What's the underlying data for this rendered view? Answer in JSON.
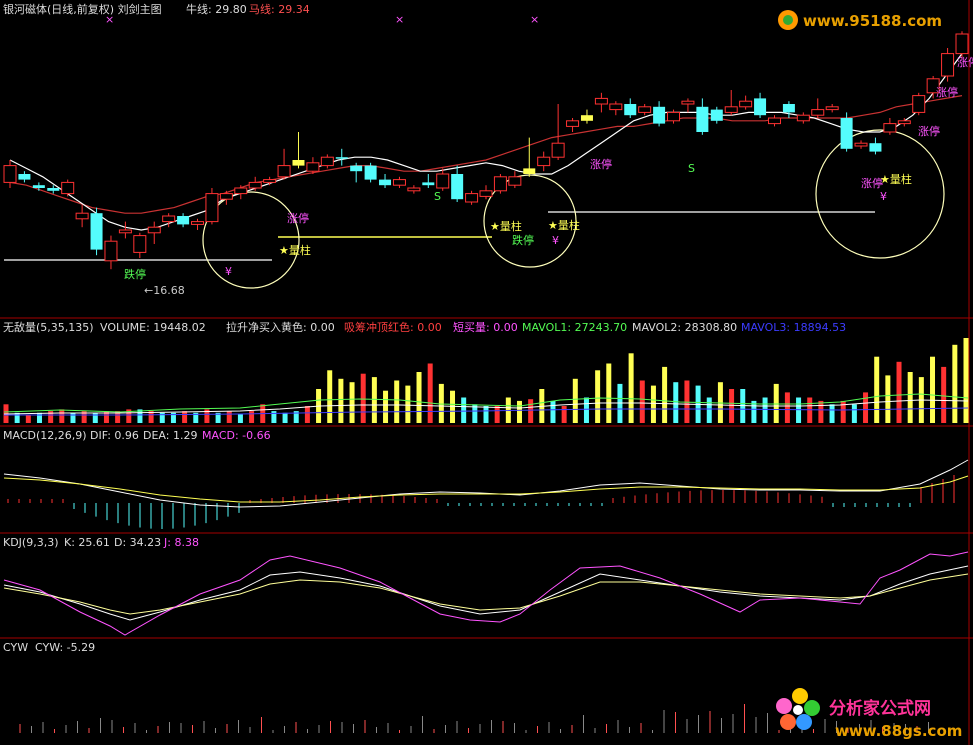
{
  "colors": {
    "background": "#000000",
    "up_candle": "#ff3232",
    "down_candle": "#54fcfc",
    "highlight_candle": "#ffff54",
    "panel_border": "#a40000",
    "ma_bull": "#ffffff",
    "ma_horse": "#c83232",
    "dif": "#ffffff",
    "dea": "#ffff54",
    "macd": "#ff54ff",
    "mavol2": "#ffffff",
    "mavol3": "#3c3cff"
  },
  "main_panel": {
    "title": "银河磁体(日线,前复权) 刘剑主图",
    "bull_label": "牛线: 29.80",
    "horse_label": "马线: 29.34",
    "low_marker": "←16.68",
    "annotations": {
      "zhangting": "涨停",
      "dieting": "跌停",
      "liangzhu": "★量柱",
      "yuan": "¥",
      "s": "S"
    }
  },
  "volume_panel": {
    "title": "无敌量(5,35,135)",
    "volume": "VOLUME: 19448.02",
    "buy": "拉升净买入黄色: 0.00",
    "sell": "吸筹冲顶红色: 0.00",
    "short": "短买量: 0.00",
    "mavol1": "MAVOL1: 27243.70",
    "mavol2": "MAVOL2: 28308.80",
    "mavol3": "MAVOL3: 18894.53"
  },
  "macd_panel": {
    "title": "MACD(12,26,9)",
    "dif": "DIF: 0.96",
    "dea": "DEA: 1.29",
    "macd": "MACD: -0.66"
  },
  "kdj_panel": {
    "title": "KDJ(9,3,3)",
    "k": "K: 25.61",
    "d": "D: 34.23",
    "j": "J: 8.38"
  },
  "cyw_panel": {
    "title": "CYW",
    "cyw": "CYW: -5.29"
  },
  "watermarks": {
    "top": "www.95188.com",
    "bottom_brand": "分析家公式网",
    "bottom_url": "www.88gs.com"
  },
  "chart_data": [
    {
      "type": "candlestick",
      "panel": "main",
      "series_labels": [
        "牛线: 29.80",
        "马线: 29.34"
      ],
      "last": {
        "bull_line": 29.8,
        "horse_line": 29.34
      },
      "annotated_low": 16.68,
      "candles": [
        {
          "o": 0.58,
          "c": 0.52,
          "h": 0.5,
          "l": 0.6
        },
        {
          "o": 0.55,
          "c": 0.57,
          "h": 0.54,
          "l": 0.58
        },
        {
          "o": 0.59,
          "c": 0.6,
          "h": 0.58,
          "l": 0.61
        },
        {
          "o": 0.6,
          "c": 0.61,
          "h": 0.59,
          "l": 0.62
        },
        {
          "o": 0.62,
          "c": 0.58,
          "h": 0.57,
          "l": 0.63
        },
        {
          "o": 0.71,
          "c": 0.69,
          "h": 0.66,
          "l": 0.74
        },
        {
          "o": 0.69,
          "c": 0.82,
          "h": 0.67,
          "l": 0.84
        },
        {
          "o": 0.86,
          "c": 0.79,
          "h": 0.77,
          "l": 0.89
        },
        {
          "o": 0.76,
          "c": 0.75,
          "h": 0.72,
          "l": 0.78
        },
        {
          "o": 0.83,
          "c": 0.77,
          "h": 0.76,
          "l": 0.85
        },
        {
          "o": 0.76,
          "c": 0.74,
          "h": 0.72,
          "l": 0.8
        },
        {
          "o": 0.72,
          "c": 0.7,
          "h": 0.69,
          "l": 0.74
        },
        {
          "o": 0.7,
          "c": 0.73,
          "h": 0.69,
          "l": 0.74
        },
        {
          "o": 0.73,
          "c": 0.72,
          "h": 0.71,
          "l": 0.75
        },
        {
          "o": 0.72,
          "c": 0.62,
          "h": 0.6,
          "l": 0.73
        },
        {
          "o": 0.64,
          "c": 0.62,
          "h": 0.61,
          "l": 0.66
        },
        {
          "o": 0.62,
          "c": 0.6,
          "h": 0.59,
          "l": 0.64
        },
        {
          "o": 0.6,
          "c": 0.58,
          "h": 0.56,
          "l": 0.61
        },
        {
          "o": 0.58,
          "c": 0.57,
          "h": 0.56,
          "l": 0.59
        },
        {
          "o": 0.56,
          "c": 0.52,
          "h": 0.46,
          "l": 0.57
        },
        {
          "o": 0.52,
          "c": 0.5,
          "h": 0.4,
          "l": 0.53
        },
        {
          "o": 0.54,
          "c": 0.51,
          "h": 0.49,
          "l": 0.55
        },
        {
          "o": 0.52,
          "c": 0.49,
          "h": 0.48,
          "l": 0.53
        },
        {
          "o": 0.49,
          "c": 0.49,
          "h": 0.46,
          "l": 0.52
        },
        {
          "o": 0.52,
          "c": 0.54,
          "h": 0.51,
          "l": 0.58
        },
        {
          "o": 0.52,
          "c": 0.57,
          "h": 0.51,
          "l": 0.58
        },
        {
          "o": 0.57,
          "c": 0.59,
          "h": 0.55,
          "l": 0.6
        },
        {
          "o": 0.59,
          "c": 0.57,
          "h": 0.56,
          "l": 0.6
        },
        {
          "o": 0.61,
          "c": 0.6,
          "h": 0.59,
          "l": 0.62
        },
        {
          "o": 0.58,
          "c": 0.59,
          "h": 0.55,
          "l": 0.6
        },
        {
          "o": 0.6,
          "c": 0.55,
          "h": 0.53,
          "l": 0.61
        },
        {
          "o": 0.55,
          "c": 0.64,
          "h": 0.52,
          "l": 0.65
        },
        {
          "o": 0.65,
          "c": 0.62,
          "h": 0.61,
          "l": 0.66
        },
        {
          "o": 0.63,
          "c": 0.61,
          "h": 0.59,
          "l": 0.64
        },
        {
          "o": 0.61,
          "c": 0.56,
          "h": 0.55,
          "l": 0.62
        },
        {
          "o": 0.59,
          "c": 0.56,
          "h": 0.54,
          "l": 0.6
        },
        {
          "o": 0.55,
          "c": 0.53,
          "h": 0.42,
          "l": 0.56
        },
        {
          "o": 0.52,
          "c": 0.49,
          "h": 0.47,
          "l": 0.54
        },
        {
          "o": 0.49,
          "c": 0.44,
          "h": 0.3,
          "l": 0.5
        },
        {
          "o": 0.38,
          "c": 0.36,
          "h": 0.35,
          "l": 0.4
        },
        {
          "o": 0.36,
          "c": 0.34,
          "h": 0.32,
          "l": 0.37
        },
        {
          "o": 0.3,
          "c": 0.28,
          "h": 0.26,
          "l": 0.33
        },
        {
          "o": 0.32,
          "c": 0.3,
          "h": 0.29,
          "l": 0.34
        },
        {
          "o": 0.3,
          "c": 0.34,
          "h": 0.28,
          "l": 0.35
        },
        {
          "o": 0.33,
          "c": 0.31,
          "h": 0.3,
          "l": 0.34
        },
        {
          "o": 0.31,
          "c": 0.37,
          "h": 0.29,
          "l": 0.38
        },
        {
          "o": 0.36,
          "c": 0.33,
          "h": 0.32,
          "l": 0.37
        },
        {
          "o": 0.3,
          "c": 0.29,
          "h": 0.28,
          "l": 0.33
        },
        {
          "o": 0.31,
          "c": 0.4,
          "h": 0.28,
          "l": 0.41
        },
        {
          "o": 0.32,
          "c": 0.36,
          "h": 0.31,
          "l": 0.37
        },
        {
          "o": 0.33,
          "c": 0.31,
          "h": 0.25,
          "l": 0.34
        },
        {
          "o": 0.31,
          "c": 0.29,
          "h": 0.27,
          "l": 0.32
        },
        {
          "o": 0.28,
          "c": 0.34,
          "h": 0.26,
          "l": 0.35
        },
        {
          "o": 0.37,
          "c": 0.35,
          "h": 0.34,
          "l": 0.38
        },
        {
          "o": 0.3,
          "c": 0.33,
          "h": 0.29,
          "l": 0.35
        },
        {
          "o": 0.36,
          "c": 0.34,
          "h": 0.33,
          "l": 0.37
        },
        {
          "o": 0.34,
          "c": 0.32,
          "h": 0.28,
          "l": 0.35
        },
        {
          "o": 0.32,
          "c": 0.31,
          "h": 0.3,
          "l": 0.33
        },
        {
          "o": 0.35,
          "c": 0.46,
          "h": 0.33,
          "l": 0.47
        },
        {
          "o": 0.45,
          "c": 0.44,
          "h": 0.43,
          "l": 0.46
        },
        {
          "o": 0.44,
          "c": 0.47,
          "h": 0.42,
          "l": 0.48
        },
        {
          "o": 0.4,
          "c": 0.37,
          "h": 0.35,
          "l": 0.41
        },
        {
          "o": 0.37,
          "c": 0.36,
          "h": 0.35,
          "l": 0.38
        },
        {
          "o": 0.33,
          "c": 0.27,
          "h": 0.26,
          "l": 0.34
        },
        {
          "o": 0.26,
          "c": 0.21,
          "h": 0.2,
          "l": 0.28
        },
        {
          "o": 0.2,
          "c": 0.12,
          "h": 0.1,
          "l": 0.22
        },
        {
          "o": 0.12,
          "c": 0.05,
          "h": 0.04,
          "l": 0.14
        }
      ],
      "bull_line": [
        0.5,
        0.53,
        0.56,
        0.6,
        0.64,
        0.68,
        0.72,
        0.74,
        0.75,
        0.74,
        0.72,
        0.7,
        0.68,
        0.64,
        0.62,
        0.6,
        0.58,
        0.56,
        0.54,
        0.52,
        0.5,
        0.49,
        0.49,
        0.5,
        0.52,
        0.54,
        0.54,
        0.53,
        0.52,
        0.51,
        0.52,
        0.54,
        0.55,
        0.55,
        0.52,
        0.48,
        0.44,
        0.4,
        0.36,
        0.34,
        0.33,
        0.33,
        0.33,
        0.34,
        0.34,
        0.33,
        0.33,
        0.33,
        0.34,
        0.35,
        0.37,
        0.39,
        0.4,
        0.4,
        0.38,
        0.34,
        0.28,
        0.2,
        0.12
      ],
      "horse_line": [
        0.58,
        0.59,
        0.61,
        0.63,
        0.65,
        0.67,
        0.68,
        0.69,
        0.69,
        0.68,
        0.67,
        0.65,
        0.63,
        0.62,
        0.6,
        0.58,
        0.57,
        0.56,
        0.55,
        0.54,
        0.53,
        0.52,
        0.52,
        0.53,
        0.54,
        0.54,
        0.53,
        0.52,
        0.51,
        0.5,
        0.48,
        0.46,
        0.44,
        0.42,
        0.41,
        0.4,
        0.39,
        0.38,
        0.38,
        0.37,
        0.36,
        0.35,
        0.35,
        0.35,
        0.36,
        0.36,
        0.36,
        0.35,
        0.35,
        0.35,
        0.35,
        0.35,
        0.34,
        0.33,
        0.31,
        0.3,
        0.29,
        0.28,
        0.27
      ]
    },
    {
      "type": "bar",
      "panel": "volume",
      "series": [
        {
          "name": "MAVOL1",
          "last": 27243.7
        },
        {
          "name": "MAVOL2",
          "last": 28308.8
        },
        {
          "name": "MAVOL3",
          "last": 18894.53
        }
      ],
      "volume_last": 19448.02,
      "bars": [
        {
          "v": 0.22,
          "c": "r"
        },
        {
          "v": 0.12,
          "c": "c"
        },
        {
          "v": 0.1,
          "c": "r"
        },
        {
          "v": 0.12,
          "c": "c"
        },
        {
          "v": 0.14,
          "c": "r"
        },
        {
          "v": 0.16,
          "c": "r"
        },
        {
          "v": 0.12,
          "c": "c"
        },
        {
          "v": 0.14,
          "c": "r"
        },
        {
          "v": 0.12,
          "c": "c"
        },
        {
          "v": 0.14,
          "c": "r"
        },
        {
          "v": 0.14,
          "c": "r"
        },
        {
          "v": 0.16,
          "c": "r"
        },
        {
          "v": 0.16,
          "c": "c"
        },
        {
          "v": 0.14,
          "c": "r"
        },
        {
          "v": 0.12,
          "c": "c"
        },
        {
          "v": 0.12,
          "c": "c"
        },
        {
          "v": 0.14,
          "c": "r"
        },
        {
          "v": 0.12,
          "c": "c"
        },
        {
          "v": 0.16,
          "c": "r"
        },
        {
          "v": 0.12,
          "c": "c"
        },
        {
          "v": 0.14,
          "c": "r"
        },
        {
          "v": 0.1,
          "c": "c"
        },
        {
          "v": 0.14,
          "c": "r"
        },
        {
          "v": 0.22,
          "c": "r"
        },
        {
          "v": 0.14,
          "c": "c"
        },
        {
          "v": 0.12,
          "c": "c"
        },
        {
          "v": 0.14,
          "c": "c"
        },
        {
          "v": 0.2,
          "c": "r"
        },
        {
          "v": 0.4,
          "c": "y"
        },
        {
          "v": 0.62,
          "c": "y"
        },
        {
          "v": 0.52,
          "c": "y"
        },
        {
          "v": 0.48,
          "c": "y"
        },
        {
          "v": 0.58,
          "c": "r"
        },
        {
          "v": 0.54,
          "c": "y"
        },
        {
          "v": 0.38,
          "c": "y"
        },
        {
          "v": 0.5,
          "c": "y"
        },
        {
          "v": 0.44,
          "c": "y"
        },
        {
          "v": 0.6,
          "c": "y"
        },
        {
          "v": 0.7,
          "c": "r"
        },
        {
          "v": 0.46,
          "c": "y"
        },
        {
          "v": 0.38,
          "c": "y"
        },
        {
          "v": 0.3,
          "c": "c"
        },
        {
          "v": 0.22,
          "c": "c"
        },
        {
          "v": 0.2,
          "c": "c"
        },
        {
          "v": 0.2,
          "c": "r"
        },
        {
          "v": 0.3,
          "c": "y"
        },
        {
          "v": 0.26,
          "c": "y"
        },
        {
          "v": 0.28,
          "c": "r"
        },
        {
          "v": 0.4,
          "c": "y"
        },
        {
          "v": 0.26,
          "c": "c"
        },
        {
          "v": 0.2,
          "c": "r"
        },
        {
          "v": 0.52,
          "c": "y"
        },
        {
          "v": 0.3,
          "c": "c"
        },
        {
          "v": 0.62,
          "c": "y"
        },
        {
          "v": 0.7,
          "c": "y"
        },
        {
          "v": 0.46,
          "c": "c"
        },
        {
          "v": 0.82,
          "c": "y"
        },
        {
          "v": 0.5,
          "c": "r"
        },
        {
          "v": 0.44,
          "c": "y"
        },
        {
          "v": 0.66,
          "c": "y"
        },
        {
          "v": 0.48,
          "c": "c"
        },
        {
          "v": 0.5,
          "c": "r"
        },
        {
          "v": 0.44,
          "c": "c"
        },
        {
          "v": 0.3,
          "c": "c"
        },
        {
          "v": 0.48,
          "c": "y"
        },
        {
          "v": 0.4,
          "c": "r"
        },
        {
          "v": 0.4,
          "c": "c"
        },
        {
          "v": 0.26,
          "c": "c"
        },
        {
          "v": 0.3,
          "c": "c"
        },
        {
          "v": 0.46,
          "c": "y"
        },
        {
          "v": 0.36,
          "c": "r"
        },
        {
          "v": 0.3,
          "c": "c"
        },
        {
          "v": 0.3,
          "c": "r"
        },
        {
          "v": 0.26,
          "c": "r"
        },
        {
          "v": 0.22,
          "c": "c"
        },
        {
          "v": 0.26,
          "c": "r"
        },
        {
          "v": 0.22,
          "c": "c"
        },
        {
          "v": 0.36,
          "c": "r"
        },
        {
          "v": 0.78,
          "c": "y"
        },
        {
          "v": 0.56,
          "c": "y"
        },
        {
          "v": 0.72,
          "c": "r"
        },
        {
          "v": 0.6,
          "c": "y"
        },
        {
          "v": 0.54,
          "c": "y"
        },
        {
          "v": 0.78,
          "c": "y"
        },
        {
          "v": 0.66,
          "c": "r"
        },
        {
          "v": 0.92,
          "c": "y"
        },
        {
          "v": 1.0,
          "c": "y"
        }
      ]
    },
    {
      "type": "line",
      "panel": "macd",
      "series": [
        {
          "name": "DIF",
          "last": 0.96
        },
        {
          "name": "DEA",
          "last": 1.29
        },
        {
          "name": "MACD",
          "last": -0.66
        }
      ]
    },
    {
      "type": "line",
      "panel": "kdj",
      "series": [
        {
          "name": "K",
          "last": 25.61
        },
        {
          "name": "D",
          "last": 34.23
        },
        {
          "name": "J",
          "last": 8.38
        }
      ]
    },
    {
      "type": "bar",
      "panel": "cyw",
      "series": [
        {
          "name": "CYW",
          "last": -5.29
        }
      ]
    }
  ]
}
